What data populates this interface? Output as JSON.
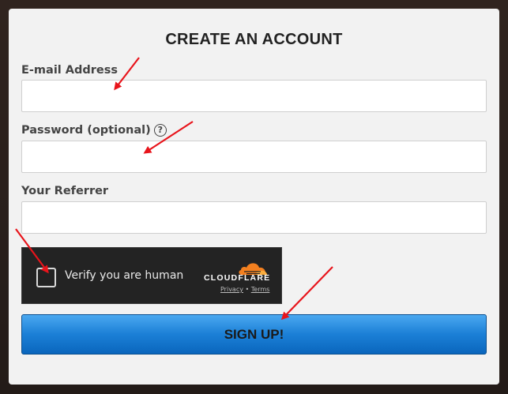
{
  "form": {
    "title": "CREATE AN ACCOUNT",
    "email_label": "E-mail Address",
    "email_value": "",
    "password_label": "Password (optional)",
    "password_help": "?",
    "password_value": "",
    "referrer_label": "Your Referrer",
    "referrer_value": "",
    "submit_label": "SIGN UP!"
  },
  "captcha": {
    "checkbox_label": "Verify you are human",
    "provider": "CLOUDFLARE",
    "privacy_link": "Privacy",
    "separator": "•",
    "terms_link": "Terms"
  },
  "colors": {
    "annotation_arrow": "#e8141b",
    "button_blue": "#1b7fd6",
    "cloudflare_orange": "#f38020"
  }
}
